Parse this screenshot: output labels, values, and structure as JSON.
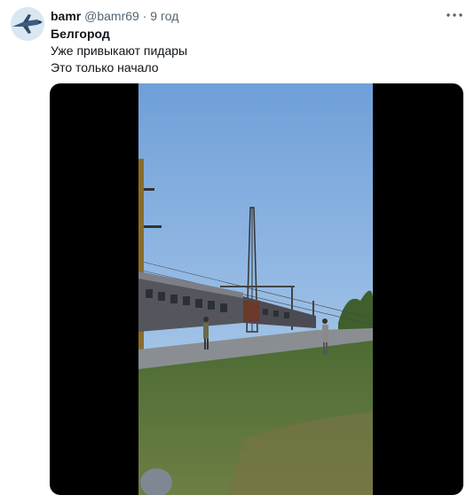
{
  "tweet": {
    "author_name": "bamr",
    "handle": "@bamr69",
    "separator": "·",
    "timestamp": "9 год",
    "lines": [
      "Белгород",
      "Уже привыкают пидары",
      "Это только начало"
    ]
  },
  "icons": {
    "avatar": "avatar-image",
    "more": "more-options-icon"
  },
  "media": {
    "type": "video",
    "scene": "train-station-video-frame"
  },
  "colors": {
    "text_primary": "#0f1419",
    "text_secondary": "#536471",
    "sky_top": "#6f9fd9",
    "grass": "#5f7a3a"
  }
}
